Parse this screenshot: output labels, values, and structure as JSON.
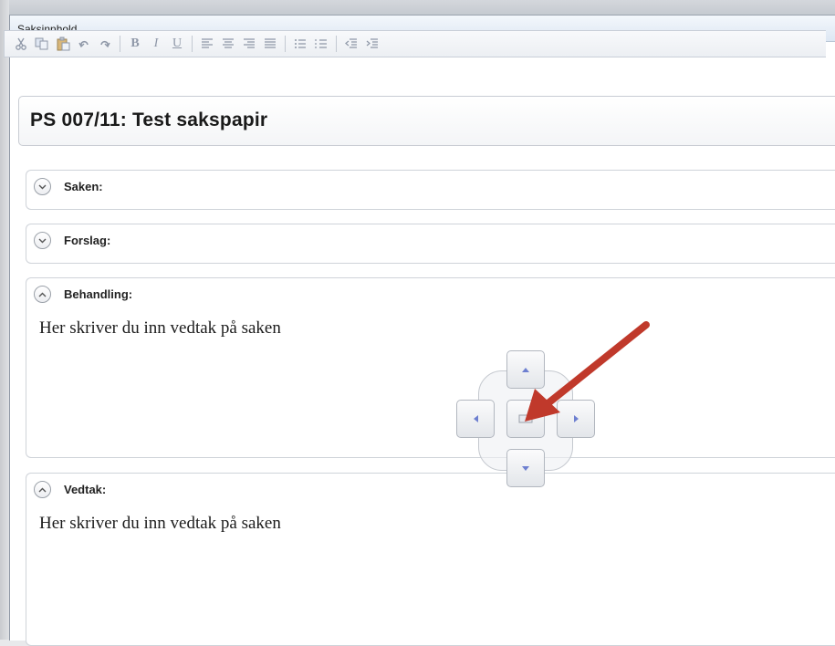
{
  "window": {
    "title": "Saksinnhold"
  },
  "toolbar": {
    "buttons": [
      {
        "name": "cut-icon",
        "glyph": "✂"
      },
      {
        "name": "copy-icon",
        "glyph": "⎘"
      },
      {
        "name": "paste-icon",
        "glyph": "📋"
      },
      {
        "name": "undo-icon",
        "glyph": "↶"
      },
      {
        "name": "redo-icon",
        "glyph": "↷"
      },
      {
        "name": "bold-icon",
        "glyph": "B"
      },
      {
        "name": "italic-icon",
        "glyph": "I"
      },
      {
        "name": "underline-icon",
        "glyph": "U"
      },
      {
        "name": "align-left-icon",
        "glyph": "≡"
      },
      {
        "name": "align-center-icon",
        "glyph": "≡"
      },
      {
        "name": "align-right-icon",
        "glyph": "≡"
      },
      {
        "name": "justify-icon",
        "glyph": "≡"
      },
      {
        "name": "bullet-list-icon",
        "glyph": "☰"
      },
      {
        "name": "numbered-list-icon",
        "glyph": "☰"
      },
      {
        "name": "outdent-icon",
        "glyph": "⇤"
      },
      {
        "name": "indent-icon",
        "glyph": "⇥"
      }
    ]
  },
  "document": {
    "title": "PS 007/11:  Test sakspapir"
  },
  "sections": {
    "saken": {
      "label": "Saken:",
      "expanded": false
    },
    "forslag": {
      "label": "Forslag:",
      "expanded": false
    },
    "behandling": {
      "label": "Behandling:",
      "expanded": true,
      "body": "Her skriver du inn vedtak på saken"
    },
    "vedtak": {
      "label": "Vedtak:",
      "expanded": true,
      "body": "Her skriver du inn vedtak på saken"
    }
  },
  "colors": {
    "annotation_arrow": "#c0392b",
    "nav_arrow": "#6d7fd0"
  }
}
